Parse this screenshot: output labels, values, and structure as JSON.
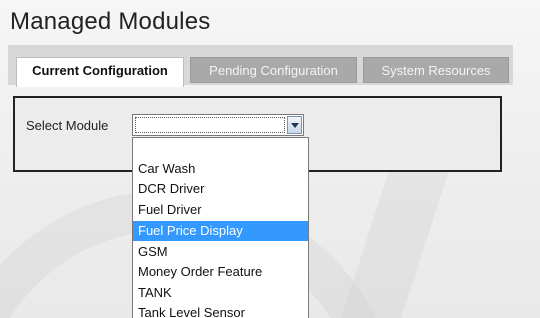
{
  "page": {
    "title": "Managed Modules"
  },
  "tabs": [
    {
      "label": "Current Configuration",
      "active": true
    },
    {
      "label": "Pending Configuration",
      "active": false
    },
    {
      "label": "System Resources",
      "active": false
    }
  ],
  "module_select": {
    "label": "Select Module",
    "value": "",
    "options": [
      "",
      "Car Wash",
      "DCR Driver",
      "Fuel Driver",
      "Fuel Price Display",
      "GSM",
      "Money Order Feature",
      "TANK",
      "Tank Level Sensor"
    ],
    "highlighted_option": "Fuel Price Display"
  },
  "icons": {
    "dropdown_arrow": "chevron-down-icon"
  },
  "colors": {
    "highlight": "#3399ff",
    "active_tab": "#ffffff",
    "inactive_tab": "#a9a9a9"
  }
}
